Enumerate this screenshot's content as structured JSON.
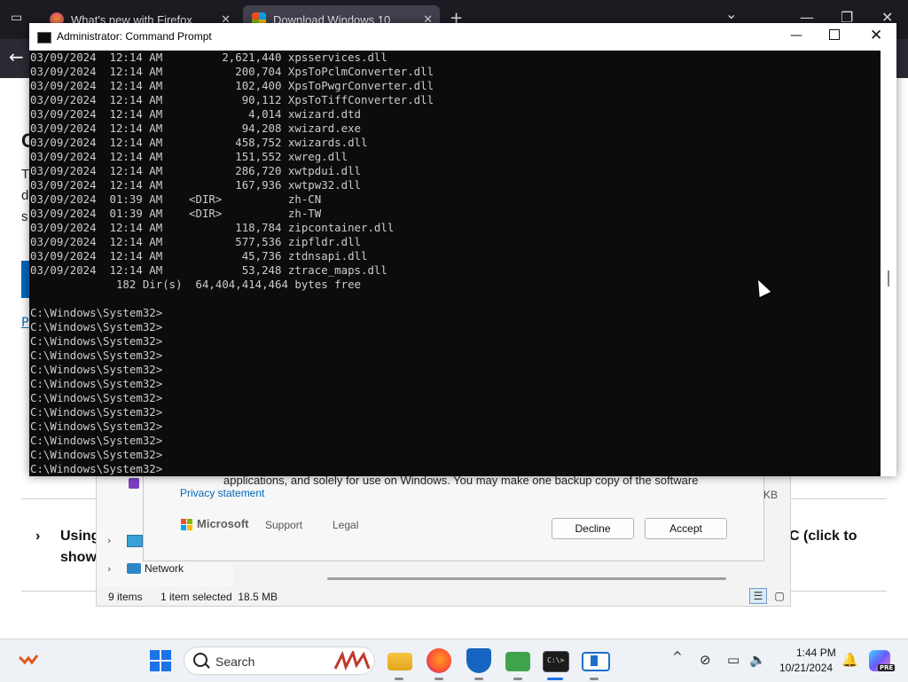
{
  "firefox": {
    "tabs": [
      {
        "label": "What's new with Firefox"
      },
      {
        "label": "Download Windows 10"
      }
    ],
    "new_tab_glyph": "+",
    "list_tabs_glyph": "⌄",
    "back_glyph": "←"
  },
  "background_page": {
    "heading_glimpse": "C",
    "letters": [
      "T",
      "d",
      "s"
    ],
    "link_glimpse": "P",
    "expander_glyph": "›",
    "item_text_1": "Using",
    "item_text_2": "show",
    "item_text_right": "C (click to"
  },
  "explorer": {
    "nav_items": [
      {
        "label": "Network"
      }
    ],
    "size_fragment": "KB",
    "status_items": "9 items",
    "status_selected": "1 item selected  18.5 MB",
    "view_details_glyph": "☰",
    "view_tiles_glyph": "▢"
  },
  "license_dialog": {
    "body_text_fragment": "applications, and solely for use on Windows. You may make one backup copy of the software",
    "privacy_link": "Privacy statement",
    "brand": "Microsoft",
    "support_link": "Support",
    "legal_link": "Legal",
    "decline_label": "Decline",
    "accept_label": "Accept",
    "brand_colors": [
      "#f25022",
      "#7fba00",
      "#00a4ef",
      "#ffb900"
    ]
  },
  "cmd": {
    "title": "Administrator: Command Prompt",
    "minimize_glyph": "—",
    "close_glyph": "✕",
    "lines": [
      "03/09/2024  12:14 AM         2,621,440 xpsservices.dll",
      "03/09/2024  12:14 AM           200,704 XpsToPclmConverter.dll",
      "03/09/2024  12:14 AM           102,400 XpsToPwgrConverter.dll",
      "03/09/2024  12:14 AM            90,112 XpsToTiffConverter.dll",
      "03/09/2024  12:14 AM             4,014 xwizard.dtd",
      "03/09/2024  12:14 AM            94,208 xwizard.exe",
      "03/09/2024  12:14 AM           458,752 xwizards.dll",
      "03/09/2024  12:14 AM           151,552 xwreg.dll",
      "03/09/2024  12:14 AM           286,720 xwtpdui.dll",
      "03/09/2024  12:14 AM           167,936 xwtpw32.dll",
      "03/09/2024  01:39 AM    <DIR>          zh-CN",
      "03/09/2024  01:39 AM    <DIR>          zh-TW",
      "03/09/2024  12:14 AM           118,784 zipcontainer.dll",
      "03/09/2024  12:14 AM           577,536 zipfldr.dll",
      "03/09/2024  12:14 AM            45,736 ztdnsapi.dll",
      "03/09/2024  12:14 AM            53,248 ztrace_maps.dll",
      "             182 Dir(s)  64,404,414,464 bytes free",
      "",
      "C:\\Windows\\System32>",
      "C:\\Windows\\System32>",
      "C:\\Windows\\System32>",
      "C:\\Windows\\System32>",
      "C:\\Windows\\System32>",
      "C:\\Windows\\System32>",
      "C:\\Windows\\System32>",
      "C:\\Windows\\System32>",
      "C:\\Windows\\System32>",
      "C:\\Windows\\System32>",
      "C:\\Windows\\System32>",
      "C:\\Windows\\System32>"
    ],
    "prompt": "C:\\Windows\\System32>",
    "console_bg": "#0c0c0c",
    "console_fg": "#cccccc"
  },
  "taskbar": {
    "search_label": "Search",
    "clock_time": "1:44 PM",
    "clock_date": "10/21/2024",
    "copilot_badge": "PRE",
    "tray_chevron": "^",
    "tb_cmd_glyph": "C:\\>",
    "accent": "#1a73e8"
  }
}
